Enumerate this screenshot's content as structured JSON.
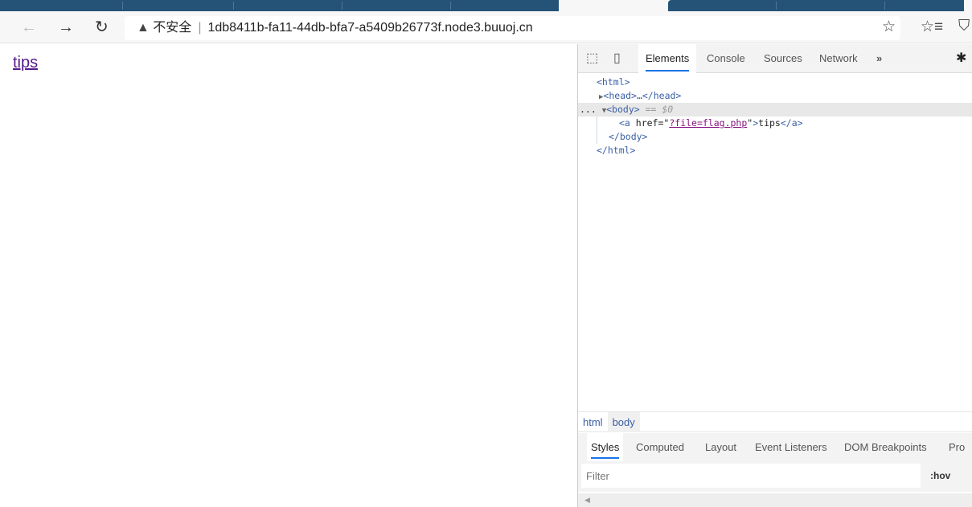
{
  "browser": {
    "url": "1db8411b-fa11-44db-bfa7-a5409b26773f.node3.buuoj.cn",
    "security_label": "不安全",
    "icons": {
      "back": "arrow-left-icon",
      "forward": "arrow-right-icon",
      "refresh": "refresh-icon",
      "warning": "warning-triangle-icon",
      "favorite": "star-icon",
      "favorites": "favorites-list-icon",
      "shield": "shield-icon"
    }
  },
  "page": {
    "link_text": "tips"
  },
  "devtools": {
    "tabs": [
      "Elements",
      "Console",
      "Sources",
      "Network",
      "»"
    ],
    "active_tab": "Elements",
    "tree": {
      "html_open": "<html>",
      "head": "<head>…</head>",
      "body_open": "<body>",
      "body_marker": "== $0",
      "a_open": "<a ",
      "a_attr": "href",
      "a_href": "?file=flag.php",
      "a_text": "tips",
      "a_close": "</a>",
      "body_close": "</body>",
      "html_close": "</html>"
    },
    "breadcrumbs": [
      "html",
      "body"
    ],
    "style_tabs": [
      "Styles",
      "Computed",
      "Layout",
      "Event Listeners",
      "DOM Breakpoints",
      "Pro"
    ],
    "filter_placeholder": "Filter",
    "hov_label": ":hov"
  },
  "colors": {
    "tabstrip": "#255378",
    "accent": "#1a73e8",
    "link": "#551a8b"
  }
}
